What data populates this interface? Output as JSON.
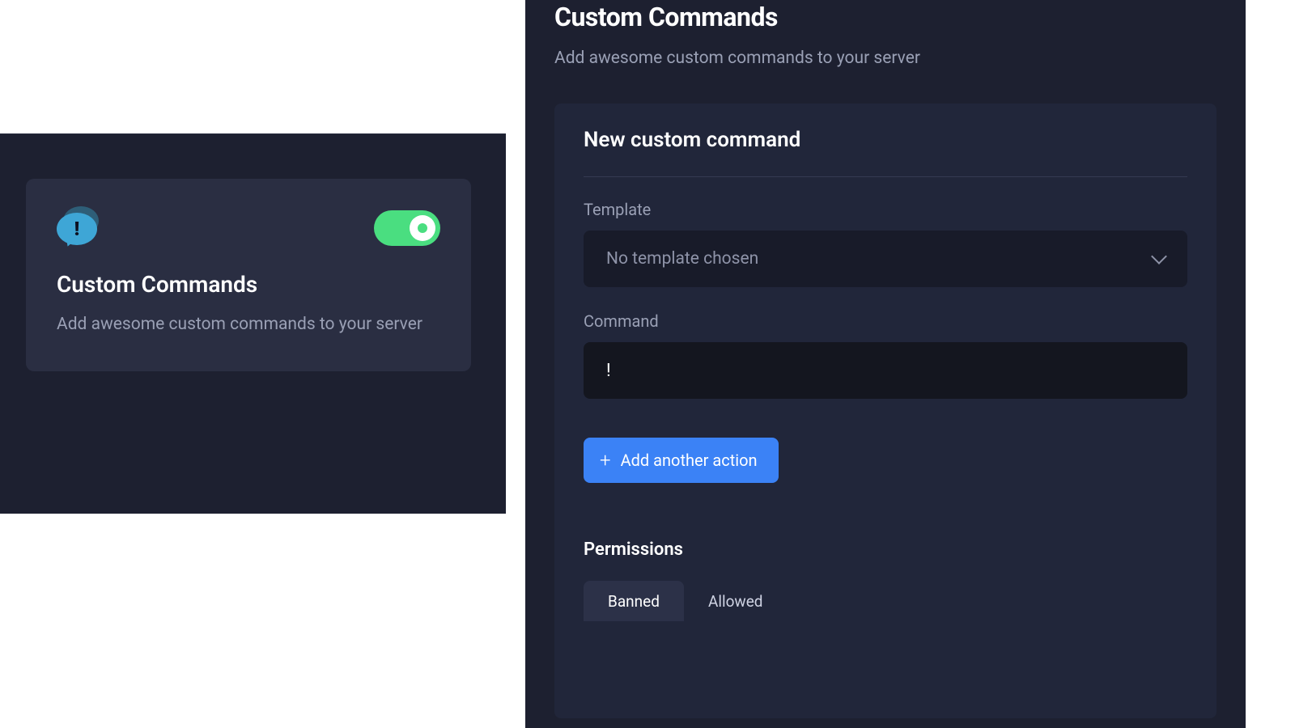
{
  "card": {
    "title": "Custom Commands",
    "description": "Add awesome custom commands to your server",
    "icon": "chat-exclamation-icon",
    "toggle_on": true
  },
  "page": {
    "title": "Custom Commands",
    "subtitle": "Add awesome custom commands to your server"
  },
  "editor": {
    "heading": "New custom command",
    "template_label": "Template",
    "template_placeholder": "No template chosen",
    "command_label": "Command",
    "command_value": "!",
    "add_action_label": "Add another action",
    "permissions_heading": "Permissions",
    "tabs": {
      "banned": "Banned",
      "allowed": "Allowed",
      "active": "banned"
    }
  }
}
